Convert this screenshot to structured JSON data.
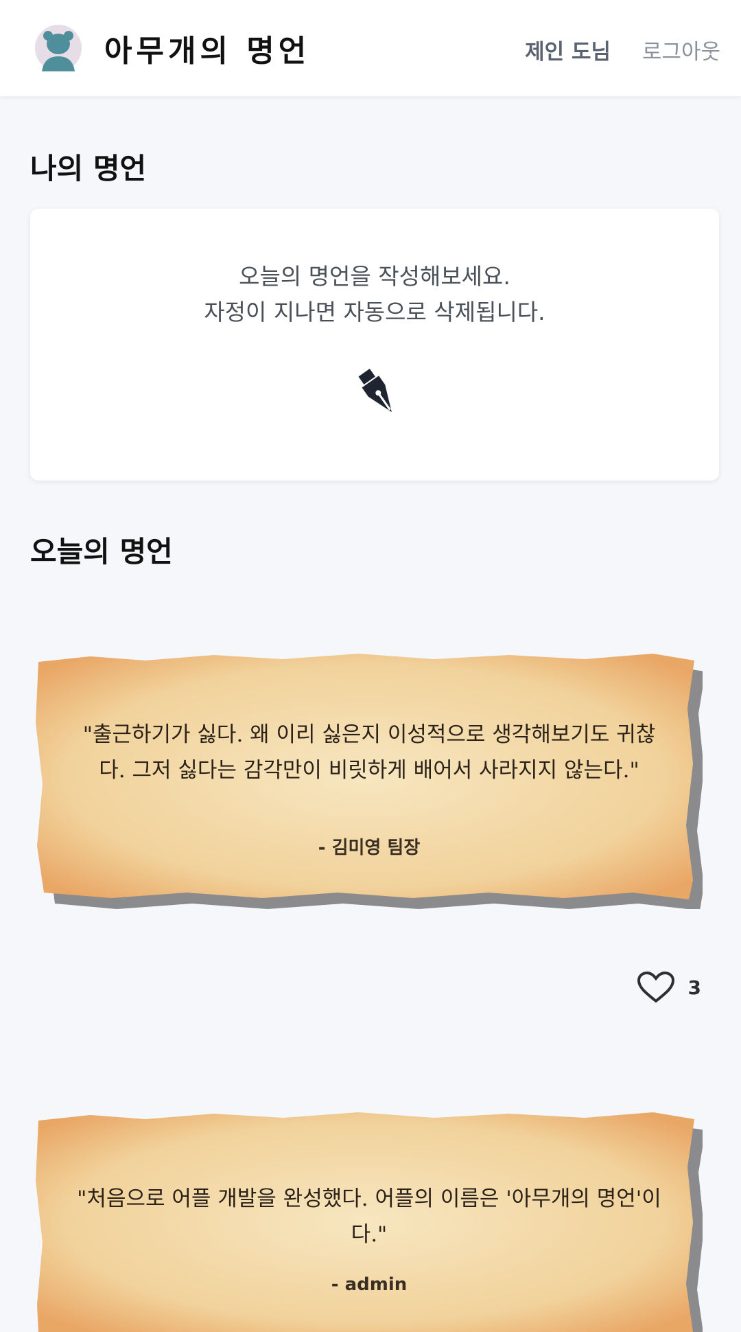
{
  "header": {
    "app_title": "아무개의 명언",
    "user_name": "제인 도님",
    "logout_label": "로그아웃",
    "avatar_icon": "bear-avatar-icon"
  },
  "my_quote": {
    "section_title": "나의 명언",
    "prompt_line1": "오늘의 명언을 작성해보세요.",
    "prompt_line2": "자정이 지나면 자동으로 삭제됩니다.",
    "icon": "fountain-pen-icon"
  },
  "today": {
    "section_title": "오늘의 명언",
    "quotes": [
      {
        "text": "\"출근하기가 싫다. 왜 이리 싫은지 이성적으로 생각해보기도 귀찮다. 그저 싫다는 감각만이 비릿하게 배어서 사라지지 않는다.\"",
        "author": "- 김미영 팀장",
        "likes": "3"
      },
      {
        "text": "\"처음으로 어플 개발을 완성했다. 어플의 이름은 '아무개의 명언'이다.\"",
        "author": "- admin"
      }
    ]
  },
  "colors": {
    "background": "#f5f7fa",
    "parchment": "#f3d9a4",
    "parchment_edge": "#e8a868"
  }
}
